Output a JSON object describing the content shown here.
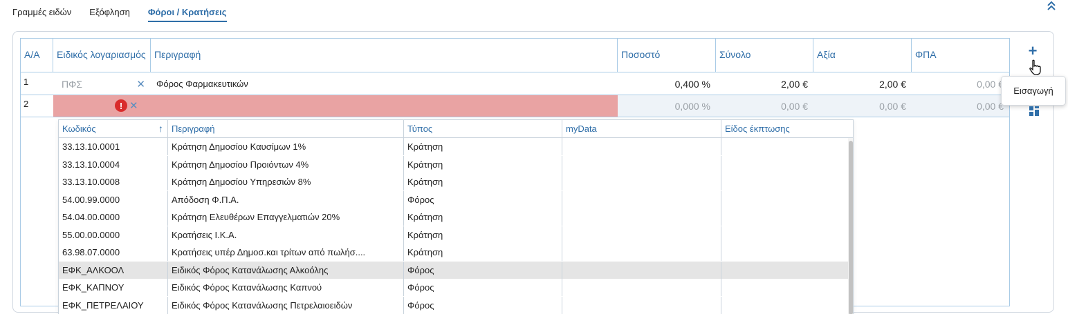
{
  "tabs": [
    {
      "label": "Γραμμές ειδών",
      "active": false
    },
    {
      "label": "Εξόφληση",
      "active": false
    },
    {
      "label": "Φόροι / Κρατήσεις",
      "active": true
    }
  ],
  "grid": {
    "columns": [
      "Α/Α",
      "Ειδικός λογαριασμός",
      "Περιγραφή",
      "Ποσοστό",
      "Σύνολο",
      "Αξία",
      "ΦΠΑ"
    ],
    "rows": [
      {
        "aa": "1",
        "account": "ΠΦΣ",
        "description": "Φόρος Φαρμακευτικών",
        "rate": "0,400 %",
        "total": "2,00 €",
        "value": "2,00 €",
        "vat": "0,00 €"
      },
      {
        "aa": "2",
        "account": "",
        "description": "",
        "rate": "0,000 %",
        "total": "0,00 €",
        "value": "0,00 €",
        "vat": "0,00 €"
      }
    ]
  },
  "side": {
    "tooltip": "Εισαγωγή",
    "icons": [
      "plus-icon",
      "hand-cursor-icon",
      "grid-layout-icon"
    ]
  },
  "dropdown": {
    "columns": [
      "Κωδικός",
      "Περιγραφή",
      "Τύπος",
      "myData",
      "Είδος έκπτωσης"
    ],
    "sort_icon": "↑",
    "rows": [
      {
        "code": "33.13.10.0001",
        "description": "Κράτηση Δημοσίου Καυσίμων 1%",
        "type": "Κράτηση",
        "mydata": "",
        "discount": ""
      },
      {
        "code": "33.13.10.0004",
        "description": "Κράτηση Δημοσίου Προιόντων 4%",
        "type": "Κράτηση",
        "mydata": "",
        "discount": ""
      },
      {
        "code": "33.13.10.0008",
        "description": "Κράτηση Δημοσίου Υπηρεσιών 8%",
        "type": "Κράτηση",
        "mydata": "",
        "discount": ""
      },
      {
        "code": "54.00.99.0000",
        "description": "Απόδοση Φ.Π.Α.",
        "type": "Φόρος",
        "mydata": "",
        "discount": ""
      },
      {
        "code": "54.04.00.0000",
        "description": "Κράτηση Ελευθέρων Επαγγελματιών 20%",
        "type": "Κράτηση",
        "mydata": "",
        "discount": ""
      },
      {
        "code": "55.00.00.0000",
        "description": "Κρατήσεις Ι.Κ.Α.",
        "type": "Κράτηση",
        "mydata": "",
        "discount": ""
      },
      {
        "code": "63.98.07.0000",
        "description": "Κρατήσεις υπέρ Δημοσ.και τρίτων από πωλήσ....",
        "type": "Κράτηση",
        "mydata": "",
        "discount": ""
      },
      {
        "code": "ΕΦΚ_ΑΛΚΟΟΛ",
        "description": "Ειδικός Φόρος Κατανάλωσης Αλκοόλης",
        "type": "Φόρος",
        "mydata": "",
        "discount": "",
        "highlighted": true
      },
      {
        "code": "ΕΦΚ_ΚΑΠΝΟΥ",
        "description": "Ειδικός Φόρος Κατανάλωσης Καπνού",
        "type": "Φόρος",
        "mydata": "",
        "discount": ""
      },
      {
        "code": "ΕΦΚ_ΠΕΤΡΕΛΑΙΟΥ",
        "description": "Ειδικός Φόρος Κατανάλωσης Πετρελαιοειδών",
        "type": "Φόρος",
        "mydata": "",
        "discount": ""
      }
    ]
  },
  "colors": {
    "accent": "#2f6ea8",
    "error_bg": "#e9a3a3",
    "error_icon": "#d92b2b",
    "border": "#a9cbe6"
  }
}
